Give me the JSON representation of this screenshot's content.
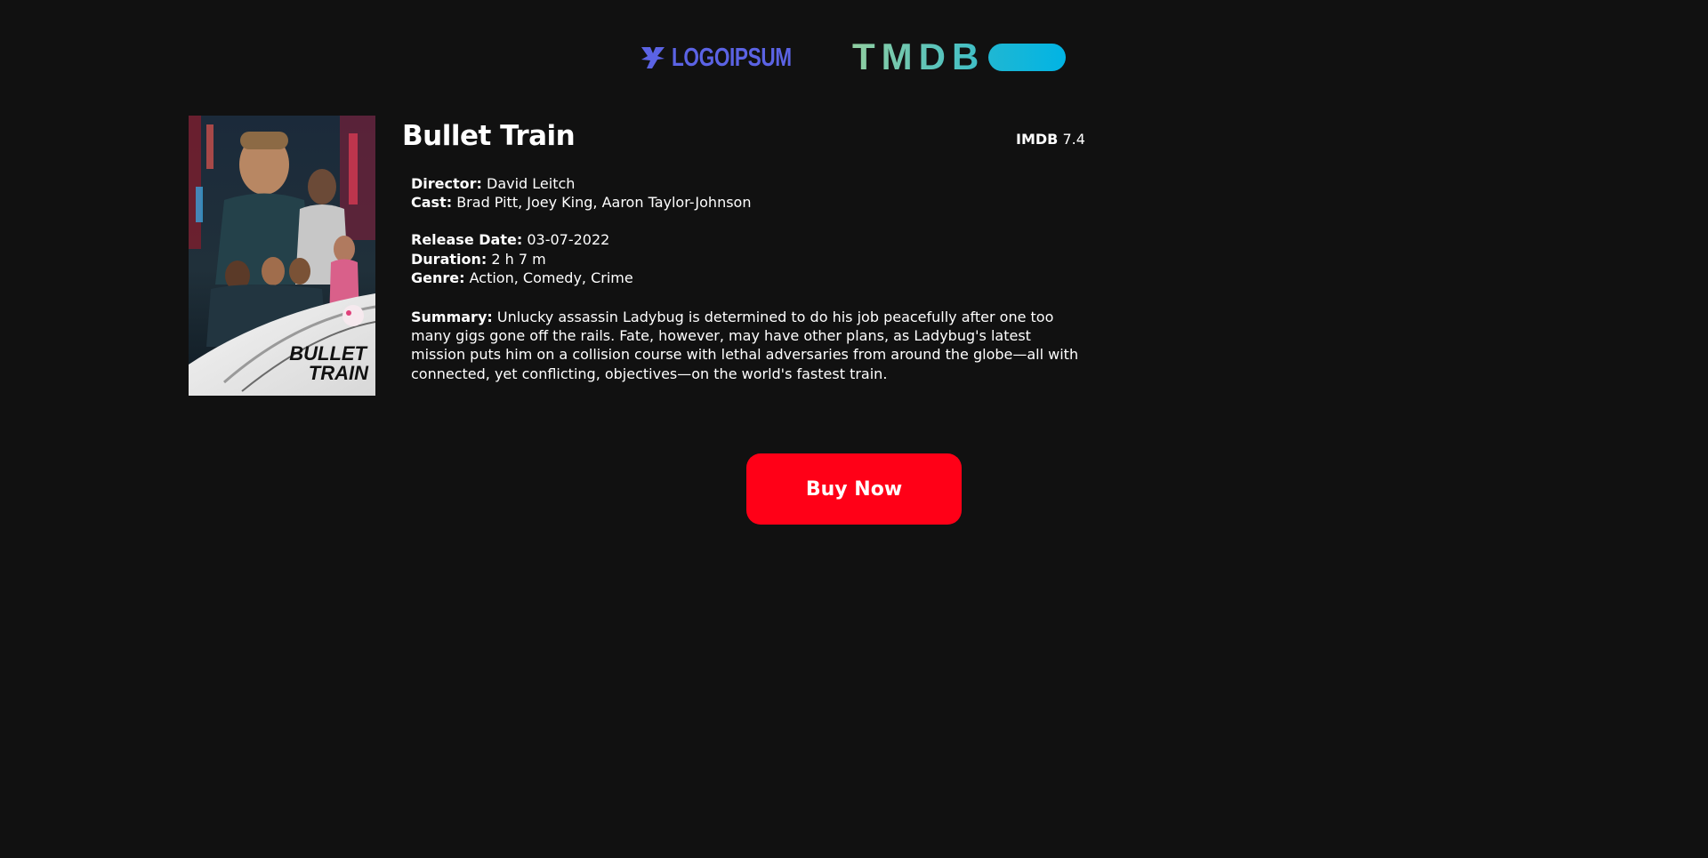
{
  "header": {
    "logo_text": "LOGOIPSUM",
    "tmdb_text": "TMDB"
  },
  "movie": {
    "title": "Bullet Train",
    "poster_text_1": "BULLET",
    "poster_text_2": "TRAIN",
    "rating_label": "IMDB",
    "rating_value": "7.4",
    "director_label": "Director:",
    "director": "David Leitch",
    "cast_label": "Cast:",
    "cast": "Brad Pitt, Joey King, Aaron Taylor-Johnson",
    "release_label": "Release Date:",
    "release_date": "03-07-2022",
    "duration_label": "Duration:",
    "duration": "2 h 7 m",
    "genre_label": "Genre:",
    "genre": "Action, Comedy, Crime",
    "summary_label": "Summary:",
    "summary": "Unlucky assassin Ladybug is determined to do his job peacefully after one too many gigs gone off the rails. Fate, however, may have other plans, as Ladybug's latest mission puts him on a collision course with lethal adversaries from around the globe—all with connected, yet conflicting, objectives—on the world's fastest train."
  },
  "actions": {
    "buy_label": "Buy Now"
  },
  "colors": {
    "background": "#111111",
    "brand_logo": "#5b63e4",
    "tmdb_green": "#90cea1",
    "tmdb_blue": "#01b4e4",
    "buy_button": "#ff0017"
  },
  "icons": {
    "logo": "logoipsum-mark-icon",
    "tmdb_pill": "tmdb-pill-icon"
  }
}
